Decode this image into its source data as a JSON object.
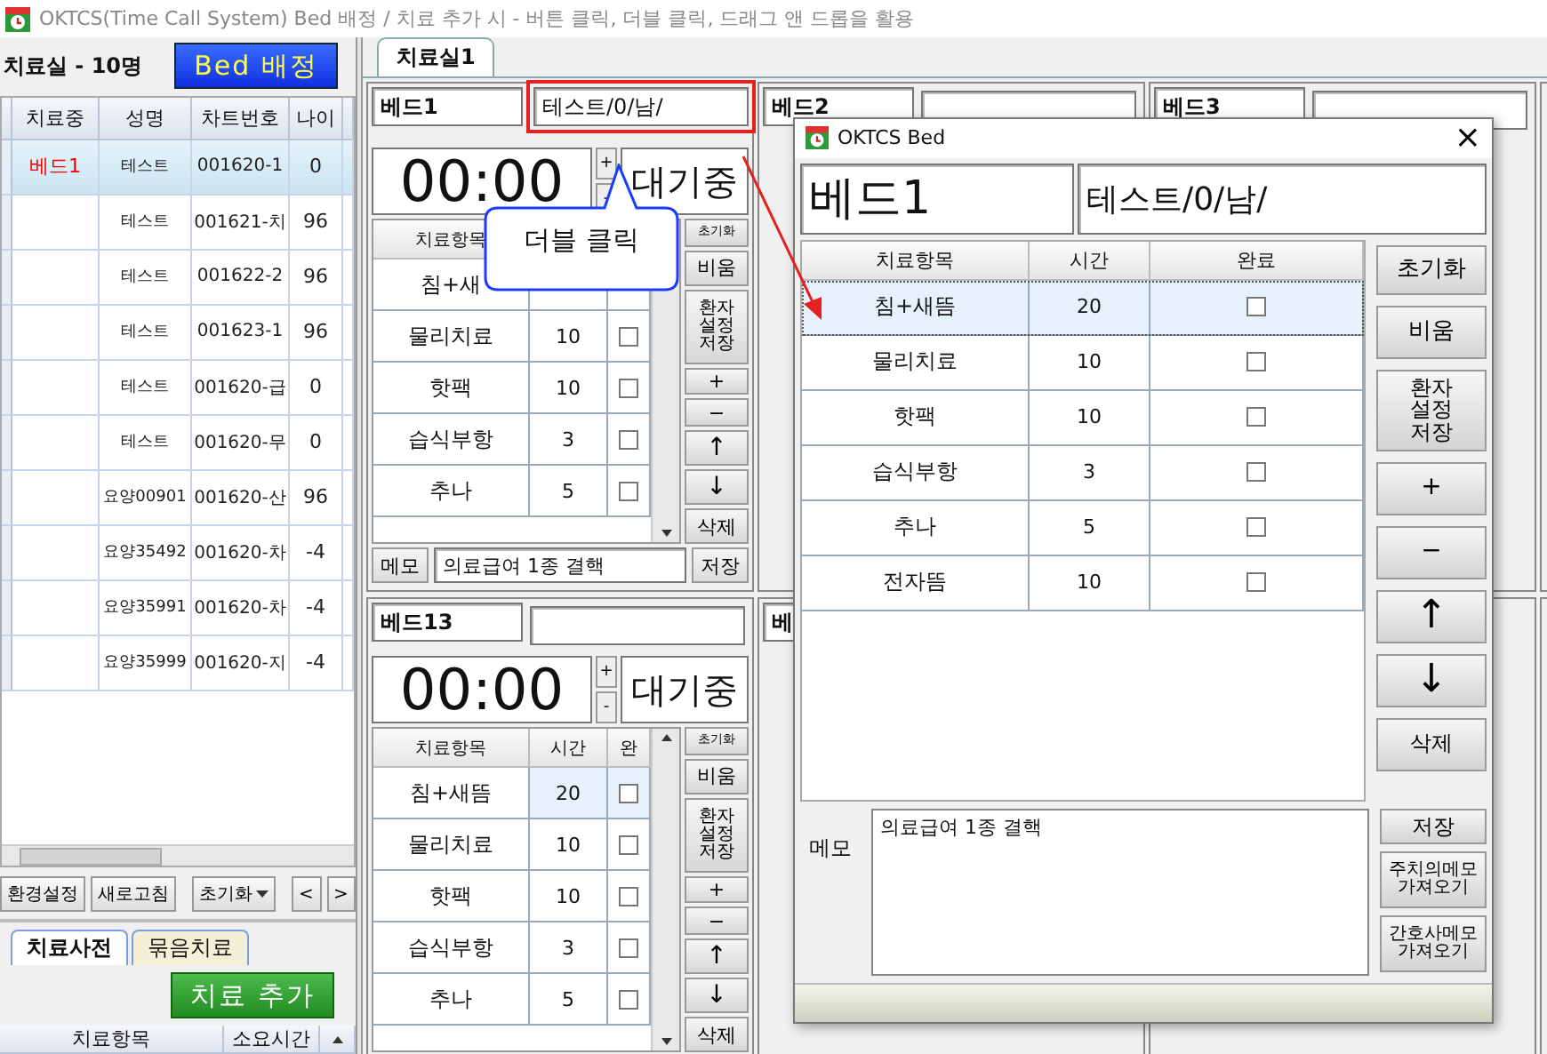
{
  "window": {
    "title": "OKTCS(Time Call System)  Bed 배정 / 치료 추가 시 - 버튼 클릭, 더블 클릭, 드래그 앤 드롭을 활용"
  },
  "room_panel": {
    "title": "치료실 - 10명",
    "assign_button": "Bed 배정",
    "columns": [
      "치료중",
      "성명",
      "차트번호",
      "나이"
    ],
    "rows": [
      {
        "bed": "베드1",
        "name": "테스트",
        "chart": "001620-1",
        "age": "0",
        "selected": true
      },
      {
        "name": "테스트",
        "chart": "001621-치",
        "age": "96",
        "selected": false
      },
      {
        "name": "테스트",
        "chart": "001622-2",
        "age": "96",
        "selected": false
      },
      {
        "name": "테스트",
        "chart": "001623-1",
        "age": "96",
        "selected": false
      },
      {
        "name": "테스트",
        "chart": "001620-급",
        "age": "0",
        "selected": false
      },
      {
        "name": "테스트",
        "chart": "001620-무",
        "age": "0",
        "selected": false
      },
      {
        "name": "요양00901",
        "chart": "001620-산",
        "age": "96",
        "selected": false
      },
      {
        "name": "요양35492",
        "chart": "001620-차",
        "age": "-4",
        "selected": false
      },
      {
        "name": "요양35991",
        "chart": "001620-차",
        "age": "-4",
        "selected": false
      },
      {
        "name": "요양35999",
        "chart": "001620-지",
        "age": "-4",
        "selected": false
      }
    ],
    "buttons": [
      "환경설정",
      "새로고침"
    ],
    "reset_menu": "초기화",
    "prev": "<",
    "next": ">",
    "tabs": [
      {
        "label": "치료사전",
        "selected": true
      },
      {
        "label": "묶음치료",
        "selected": false
      }
    ],
    "add_button": "치료 추가",
    "dict_columns": [
      "치료항목",
      "소요시간"
    ]
  },
  "room_tabs": [
    {
      "label": "치료실1",
      "selected": true
    }
  ],
  "beds": [
    {
      "name": "베드1",
      "patient_field": true,
      "patient": "테스트/0/남/",
      "highlighted": true,
      "timer": "00:00",
      "plus": "+",
      "minus": "-",
      "status": "대기중",
      "columns": [
        "치료항목"
      ],
      "rows": [
        {
          "item": "침+새",
          "selected": false
        },
        {
          "item": "물리치료",
          "time": "10",
          "done": false,
          "selected": false
        },
        {
          "item": "핫팩",
          "time": "10",
          "done": false,
          "selected": false
        },
        {
          "item": "습식부항",
          "time": "3",
          "done": false,
          "selected": false
        },
        {
          "item": "추나",
          "time": "5",
          "done": false,
          "selected": false
        }
      ],
      "side_buttons": [
        "초기화",
        "비움",
        "환자\n설정\n저장",
        "+",
        "−",
        "↑",
        "↓",
        "삭제"
      ],
      "memo_label": "메모",
      "memo": "의료급여 1종 결핵",
      "save": "저장"
    },
    {
      "name": "베드2",
      "patient_field": true
    },
    {
      "name": "베드3",
      "patient_field": true
    },
    {
      "name": "베드13",
      "patient_field": true,
      "timer": "00:00",
      "plus": "+",
      "minus": "-",
      "status": "대기중",
      "columns": [
        "치료항목",
        "시간",
        "완"
      ],
      "rows": [
        {
          "item": "침+새뜸",
          "time": "20",
          "done": false,
          "selected": true
        },
        {
          "item": "물리치료",
          "time": "10",
          "done": false,
          "selected": false
        },
        {
          "item": "핫팩",
          "time": "10",
          "done": false,
          "selected": false
        },
        {
          "item": "습식부항",
          "time": "3",
          "done": false,
          "selected": false
        },
        {
          "item": "추나",
          "time": "5",
          "done": false,
          "selected": false
        }
      ],
      "side_buttons": [
        "초기화",
        "비움",
        "환자\n설정\n저장",
        "+",
        "−",
        "↑",
        "↓",
        "삭제"
      ]
    },
    {
      "name": "베"
    }
  ],
  "callout": {
    "text": "더블 클릭"
  },
  "dialog": {
    "title": "OKTCS Bed",
    "close": "×",
    "name": "베드1",
    "patient": "테스트/0/남/",
    "columns": [
      "치료항목",
      "시간",
      "완료"
    ],
    "rows": [
      {
        "item": "침+새뜸",
        "time": "20",
        "done": false,
        "selected": true
      },
      {
        "item": "물리치료",
        "time": "10",
        "done": false,
        "selected": false
      },
      {
        "item": "핫팩",
        "time": "10",
        "done": false,
        "selected": false
      },
      {
        "item": "습식부항",
        "time": "3",
        "done": false,
        "selected": false
      },
      {
        "item": "추나",
        "time": "5",
        "done": false,
        "selected": false
      },
      {
        "item": "전자뜸",
        "time": "10",
        "done": false,
        "selected": false
      }
    ],
    "side_buttons": [
      "초기화",
      "비움",
      "환자\n설정\n저장",
      "+",
      "−",
      "↑",
      "↓",
      "삭제"
    ],
    "memo_label": "메모",
    "memo": "의료급여 1종 결핵",
    "memo_buttons": [
      "저장",
      "주치의메모\n가져오기",
      "간호사메모\n가져오기"
    ]
  }
}
